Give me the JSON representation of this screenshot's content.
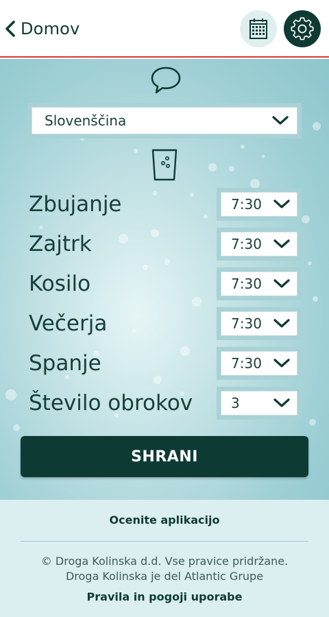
{
  "header": {
    "back_label": "Domov",
    "back_icon": "chevron-left-icon",
    "calendar_icon": "calendar-icon",
    "settings_icon": "gear-icon",
    "accent_line_color": "#e0342a",
    "brand_color": "#0d3b33"
  },
  "language": {
    "icon": "speech-bubble-icon",
    "selected": "Slovenščina"
  },
  "meals": {
    "icon": "water-glass-icon",
    "rows": [
      {
        "label": "Zbujanje",
        "time": "7:30"
      },
      {
        "label": "Zajtrk",
        "time": "7:30"
      },
      {
        "label": "Kosilo",
        "time": "7:30"
      },
      {
        "label": "Večerja",
        "time": "7:30"
      },
      {
        "label": "Spanje",
        "time": "7:30"
      },
      {
        "label": "Število obrokov",
        "time": "3"
      }
    ]
  },
  "save_label": "SHRANI",
  "footer": {
    "rate_label": "Ocenite aplikacijo",
    "copyright_line1": "© Droga Kolinska d.d. Vse pravice pridržane.",
    "copyright_line2": "Droga Kolinska je del Atlantic Grupe",
    "terms_label": "Pravila in pogoji uporabe"
  }
}
